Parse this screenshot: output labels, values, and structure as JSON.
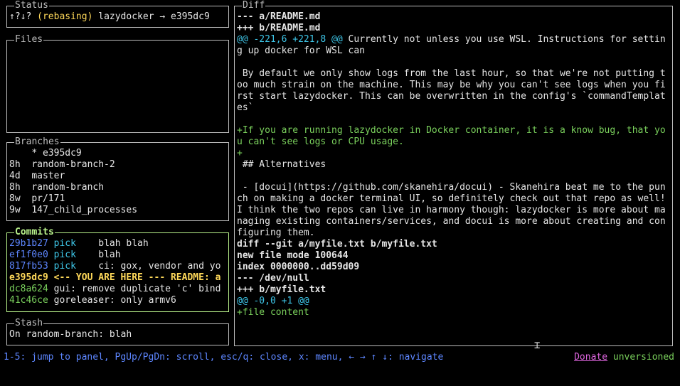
{
  "status": {
    "title": "Status",
    "arrows": "↑?↓?",
    "rebasing": "(rebasing)",
    "repo": "lazydocker → e395dc9"
  },
  "files": {
    "title": "Files"
  },
  "branches": {
    "title": "Branches",
    "rows": [
      {
        "age": "  ",
        "name": "* e395dc9"
      },
      {
        "age": "8h",
        "name": "random-branch-2"
      },
      {
        "age": "4d",
        "name": "master"
      },
      {
        "age": "8h",
        "name": "random-branch"
      },
      {
        "age": "8w",
        "name": "pr/171"
      },
      {
        "age": "9w",
        "name": "147_child_processes"
      }
    ]
  },
  "commits": {
    "title": "Commits",
    "rows": [
      {
        "hash": "29b1b27",
        "action": "pick",
        "message": "blah blah"
      },
      {
        "hash": "ef1f0e0",
        "action": "pick",
        "message": "blah"
      },
      {
        "hash": "817fb53",
        "action": "pick",
        "message": "ci: gox, vendor and yo"
      },
      {
        "hash": "e395dc9",
        "action": "",
        "message": "<-- YOU ARE HERE --- README: a"
      },
      {
        "hash": "dc8a624",
        "action": "",
        "message": "gui: remove duplicate 'c' bind"
      },
      {
        "hash": "41c46ce",
        "action": "",
        "message": "goreleaser: only armv6"
      }
    ]
  },
  "stash": {
    "title": "Stash",
    "rows": [
      "On random-branch: blah"
    ]
  },
  "diff": {
    "title": "Diff",
    "lines": [
      {
        "kind": "header",
        "text": "--- a/README.md"
      },
      {
        "kind": "header",
        "text": "+++ b/README.md"
      },
      {
        "kind": "hunk",
        "hunk": "@@ -221,6 +221,8 @@",
        "text": " Currently not unless you use WSL. Instructions for setting up docker for WSL can"
      },
      {
        "kind": "context",
        "text": ""
      },
      {
        "kind": "context",
        "text": " By default we only show logs from the last hour, so that we're not putting too much strain on the machine. This may be why you can't see logs when you first start lazydocker. This can be overwritten in the config's `commandTemplates`"
      },
      {
        "kind": "context",
        "text": ""
      },
      {
        "kind": "add",
        "text": "+If you are running lazydocker in Docker container, it is a know bug, that you can't see logs or CPU usage."
      },
      {
        "kind": "add",
        "text": "+"
      },
      {
        "kind": "context",
        "text": " ## Alternatives"
      },
      {
        "kind": "context",
        "text": ""
      },
      {
        "kind": "context",
        "text": " - [docui](https://github.com/skanehira/docui) - Skanehira beat me to the punch on making a docker terminal UI, so definitely check out that repo as well! I think the two repos can live in harmony though: lazydocker is more about managing existing containers/services, and docui is more about creating and configuring them."
      },
      {
        "kind": "header",
        "text": "diff --git a/myfile.txt b/myfile.txt"
      },
      {
        "kind": "header",
        "text": "new file mode 100644"
      },
      {
        "kind": "header",
        "text": "index 0000000..dd59d09"
      },
      {
        "kind": "header",
        "text": "--- /dev/null"
      },
      {
        "kind": "header",
        "text": "+++ b/myfile.txt"
      },
      {
        "kind": "hunk",
        "hunk": "@@ -0,0 +1 @@",
        "text": ""
      },
      {
        "kind": "add",
        "text": "+file content"
      }
    ]
  },
  "footer": {
    "keys": "1-5: jump to panel, PgUp/PgDn: scroll, esc/q: close, x: menu, ← → ↑ ↓: navigate",
    "donate": "Donate",
    "version": "unversioned"
  },
  "colors": {
    "background": "#000000",
    "border": "#bdbdbd",
    "active_border": "#b8f18a",
    "hash": "#5d86ff",
    "current_commit": "#ffd95a",
    "pushed_commit": "#7ad05c",
    "action": "#3ec6e8",
    "added_line": "#7ad05c",
    "donate": "#e066e0"
  },
  "icons": {
    "cursor": "text-cursor-icon"
  }
}
